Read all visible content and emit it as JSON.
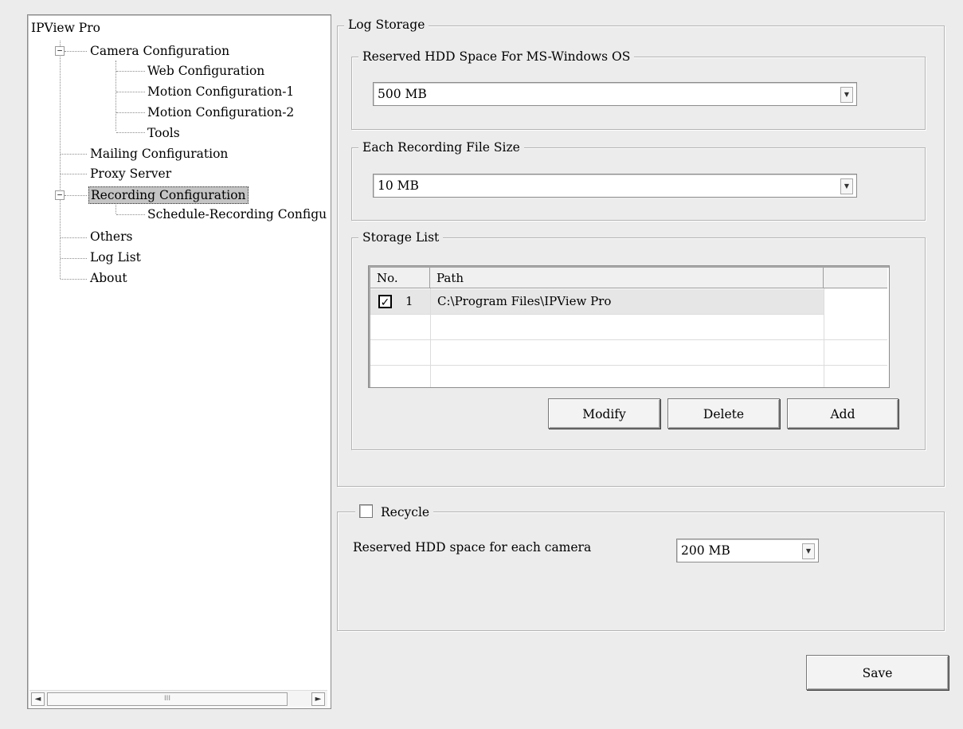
{
  "tree": {
    "root": "IPView Pro",
    "items": [
      {
        "label": "Camera Configuration",
        "expander": "−"
      },
      {
        "label": "Web Configuration"
      },
      {
        "label": "Motion Configuration-1"
      },
      {
        "label": "Motion Configuration-2"
      },
      {
        "label": "Tools"
      },
      {
        "label": "Mailing Configuration"
      },
      {
        "label": "Proxy Server"
      },
      {
        "label": "Recording Configuration",
        "expander": "−",
        "selected": true
      },
      {
        "label": "Schedule-Recording Configu"
      },
      {
        "label": "Others"
      },
      {
        "label": "Log List"
      },
      {
        "label": "About"
      }
    ],
    "scroll_left": "◄",
    "scroll_right": "►",
    "scroll_thumb": "III"
  },
  "log_storage": {
    "title": "Log Storage",
    "reserved_hdd": {
      "title": "Reserved HDD Space For MS-Windows OS",
      "value": "500 MB"
    },
    "file_size": {
      "title": "Each Recording File Size",
      "value": "10 MB"
    },
    "storage_list": {
      "title": "Storage List",
      "columns": [
        "No.",
        "Path",
        ""
      ],
      "rows": [
        {
          "checked": true,
          "no": "1",
          "path": "C:\\Program Files\\IPView Pro"
        }
      ],
      "buttons": {
        "modify": "Modify",
        "delete": "Delete",
        "add": "Add"
      }
    }
  },
  "recycle": {
    "label": "Recycle",
    "checked": false,
    "reserved_label": "Reserved HDD space for each camera",
    "reserved_value": "200 MB"
  },
  "save_label": "Save",
  "icons": {
    "checkmark": "check-icon",
    "dropdown": "chevron-down-icon"
  }
}
